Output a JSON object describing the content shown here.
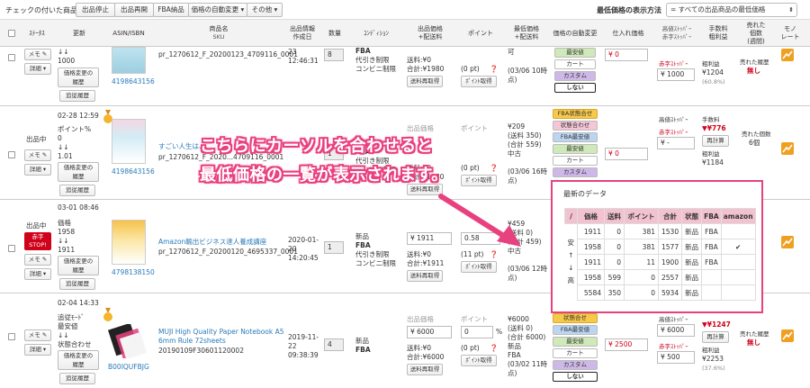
{
  "toolbar": {
    "checked_label": "チェックの付いた商品を",
    "buttons": [
      "出品停止",
      "出品再開",
      "FBA納品",
      "価格の自動変更 ▾",
      "その他 ▾"
    ],
    "lowest_label": "最低価格の表示方法",
    "lowest_select": "= すべての出品商品の最低価格"
  },
  "header": {
    "status": "ｽﾃｰﾀｽ",
    "updated": "更新",
    "asin": "ASIN/ISBN",
    "product_name": "商品名",
    "sku": "SKU",
    "created_1": "出品情報",
    "created_2": "作成日",
    "quantity": "数量",
    "condition": "ｺﾝﾃﾞｨｼｮﾝ",
    "price_1": "出品価格",
    "price_2": "+配送料",
    "point": "ポイント",
    "lowest_1": "最低価格",
    "lowest_2": "+配送料",
    "auto_change": "価格の自動変更",
    "cost": "仕入れ価格",
    "stopper_high": "高値ｽﾄｯﾊﾟｰ",
    "stopper_low": "赤字ｽﾄｯﾊﾟｰ",
    "fee": "手数料",
    "gross": "粗利益",
    "sold_1": "売れた",
    "sold_2": "個数",
    "sold_3": "(週間)",
    "mono_1": "モノ",
    "mono_2": "レート"
  },
  "rows": [
    {
      "memo": "メモ",
      "detail": "詳細",
      "updated": "↓↓",
      "value": "1000",
      "history1": "価格変更の",
      "history2": "履歴",
      "add": "追従履歴",
      "asin": "4198643156",
      "sku": "pr_1270612_F_20200123_4709116_0001",
      "created_time": "12:46:31",
      "created_day": "23",
      "qty": "8",
      "cond1": "FBA",
      "cond2": "代引き制限",
      "cond3": "コンビニ制限",
      "ship": "送料:¥0",
      "total": "合計:¥1980",
      "recalc": "送料再取得",
      "point": "(0 pt)",
      "point_btn": "ﾎﾟｲﾝﾄ取得",
      "lowest1": "可",
      "lowest2": "(03/06 10時",
      "lowest3": "点)",
      "chips": [
        "最安値",
        "カート",
        "カスタム",
        "しない"
      ],
      "cost": "0",
      "stop_low": "赤字ｽﾄｯﾊﾟｰ",
      "stop_val": "1000",
      "gross_label": "粗利益",
      "gross": "¥1204",
      "gross_pct": "(60.8%)",
      "sold": "売れた履歴",
      "sold2": "無し"
    },
    {
      "status": "出品中",
      "memo": "メモ",
      "detail": "詳細",
      "updated": "02-28 12:59",
      "line1": "ポイント%",
      "line2": "0",
      "line3": "↓↓",
      "line4": "1.01",
      "history1": "価格変更の",
      "history2": "履歴",
      "add": "追従履歴",
      "asin": "4198643156",
      "title": "すごい人生は、...",
      "sku": "pr_1270612_F_2020...4709116_0001",
      "qty": "1",
      "cond1": "FBA",
      "cond2": "代引き制限",
      "cond3": "コンビニ制限",
      "price_label": "出品価格",
      "ship": "送料:¥0",
      "total": "合計:¥1980",
      "recalc": "送料再取得",
      "point": "(0 pt)",
      "point_btn": "ﾎﾟｲﾝﾄ取得",
      "point_label": "ポイント",
      "lowest1": "¥209",
      "lowest2": "(送料 350)",
      "lowest3": "(合計 559)",
      "lowest4": "中古",
      "lowest5": "(03/06 16時",
      "lowest6": "点)",
      "chips": [
        "FBA状態合せ",
        "状態合わせ",
        "FBA最安値",
        "最安値",
        "カート",
        "カスタム"
      ],
      "cost": "0",
      "stop_high": "高値ｽﾄｯﾊﾟｰ",
      "stop_low": "赤字ｽﾄｯﾊﾟｰ",
      "stop_val": "-",
      "fee_label": "手数料",
      "fee": "¥776",
      "recalc2": "再計算",
      "gross_label": "粗利益",
      "gross": "¥1184",
      "sold_label": "売れた個数",
      "sold_val": "6個"
    },
    {
      "status": "出品中",
      "red_badge": "赤字STOP!",
      "memo": "メモ",
      "detail": "詳細",
      "updated": "03-01 08:46",
      "line1": "価格",
      "line2": "1958",
      "line3": "↓↓",
      "line4": "1911",
      "history1": "価格変更の",
      "history2": "履歴",
      "add": "追従履歴",
      "asin": "4798138150",
      "title": "Amazon輸出ビジネス達人養成講座",
      "sku": "pr_1270612_F_20200120_4695337_0001",
      "created1": "2020-01-",
      "created2": "20",
      "created3": "14:20:45",
      "qty": "1",
      "cond0": "新品",
      "cond1": "FBA",
      "cond2": "代引き制限",
      "cond3": "コンビニ制限",
      "price": "1911",
      "ship": "送料:¥0",
      "total": "合計:¥1911",
      "recalc": "送料再取得",
      "point_val": "0.58",
      "point": "(11 pt)",
      "point_btn": "ﾎﾟｲﾝﾄ取得",
      "lowest1": "¥459",
      "lowest2": "(送料 0)",
      "lowest3": "(合計 459)",
      "lowest4": "中古",
      "lowest5": "(03/06 12時",
      "lowest6": "点)"
    },
    {
      "memo": "メモ",
      "detail": "詳細",
      "updated": "02-04 14:33",
      "line1": "追従ﾓｰﾄﾞ",
      "line2": "最安値",
      "line3": "↓↓",
      "line4": "状態合わせ",
      "history1": "価格変更の",
      "history2": "履歴",
      "add": "追従履歴",
      "asin": "B00IQUFBJG",
      "title1": "MUJI High Quality Paper Notebook A5",
      "title2": "6mm Rule 72sheets",
      "sku": "20190109F30601120002",
      "created1": "2019-11-",
      "created2": "22",
      "created3": "09:38:39",
      "qty": "4",
      "cond0": "新品",
      "cond1": "FBA",
      "price_label": "出品価格",
      "price": "6000",
      "ship": "送料:¥0",
      "total": "合計:¥6000",
      "recalc": "送料再取得",
      "point_val": "0",
      "point_unit": "%",
      "point": "(0 pt)",
      "point_btn": "ﾎﾟｲﾝﾄ取得",
      "point_label": "ポイント",
      "lowest1": "¥6000",
      "lowest2": "(送料 0)",
      "lowest3": "(合計 6000)",
      "lowest4": "新品",
      "lowest5": "FBA",
      "lowest6": "(03/02 11時",
      "lowest7": "点)",
      "chips": [
        "状態合せ",
        "FBA最安値",
        "最安値",
        "カート",
        "カスタム",
        "しない"
      ],
      "cost": "2500",
      "stop_high": "高値ｽﾄｯﾊﾟｰ",
      "stop_high_val": "6000",
      "stop_low": "赤字ｽﾄｯﾊﾟｰ",
      "stop_val": "500",
      "fee": "¥1247",
      "recalc2": "再計算",
      "gross_label": "粗利益",
      "gross": "¥2253",
      "gross_pct": "(37.6%)",
      "sold": "売れた履歴",
      "sold2": "無し"
    }
  ],
  "callout": {
    "line1": "こちらにカーソルを合わせると",
    "line2": "最低価格の一覧が表示されます。"
  },
  "popup": {
    "title": "最新のデータ",
    "headers": [
      "/",
      "価格",
      "送料",
      "ポイント",
      "合計",
      "状態",
      "FBA",
      "amazon"
    ],
    "side": [
      "安",
      "↑",
      "↓",
      "高"
    ],
    "rows": [
      [
        "1911",
        "0",
        "381",
        "1530",
        "新品",
        "FBA",
        ""
      ],
      [
        "1958",
        "0",
        "381",
        "1577",
        "新品",
        "FBA",
        "✔"
      ],
      [
        "1911",
        "0",
        "11",
        "1900",
        "新品",
        "FBA",
        ""
      ],
      [
        "1958",
        "599",
        "0",
        "2557",
        "新品",
        "",
        ""
      ],
      [
        "5584",
        "350",
        "0",
        "5934",
        "新品",
        "",
        ""
      ]
    ]
  },
  "colors": {
    "accent": "#e8417f",
    "link": "#2a7ab8",
    "danger": "#d0021b"
  }
}
